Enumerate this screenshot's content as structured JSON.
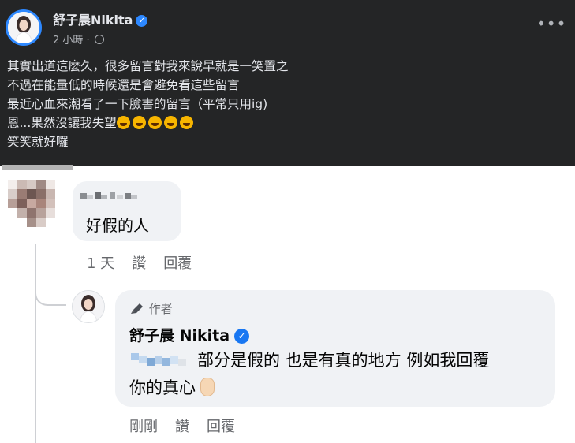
{
  "post": {
    "author": "舒子晨Nikita",
    "verified_icon": "verified-badge-icon",
    "time": "2 小時",
    "separator": "·",
    "privacy_icon": "globe-icon",
    "more_icon": "more-options-icon",
    "more_label": "•••",
    "lines": [
      "其實出道這麼久，很多留言對我來說早就是一笑置之",
      "不過在能量低的時候還是會避免看這些留言",
      "最近心血來潮看了一下臉書的留言（平常只用ig)",
      "恩...果然沒讓我失望",
      "笑笑就好囉"
    ],
    "emoji_count": 5,
    "emoji_icon": "rolling-laughing-emoji-icon"
  },
  "comment": {
    "text": "好假的人",
    "time": "1 天",
    "like": "讚",
    "reply": "回覆"
  },
  "reply": {
    "author_tag": "作者",
    "author_tag_icon": "pen-icon",
    "author": "舒子晨 Nikita",
    "line1": "部分是假的 也是有真的地方 例如我回覆",
    "line2": "你的真心",
    "hand_icon": "heart-fingers-emoji-icon",
    "time": "剛剛",
    "like": "讚",
    "reply": "回覆"
  },
  "colors": {
    "post_bg": "#242526",
    "post_text": "#e4e6eb",
    "secondary_text": "#b0b3b8",
    "bubble_bg": "#f0f2f5",
    "verified_blue": "#1877f2",
    "action_text": "#65676b"
  }
}
